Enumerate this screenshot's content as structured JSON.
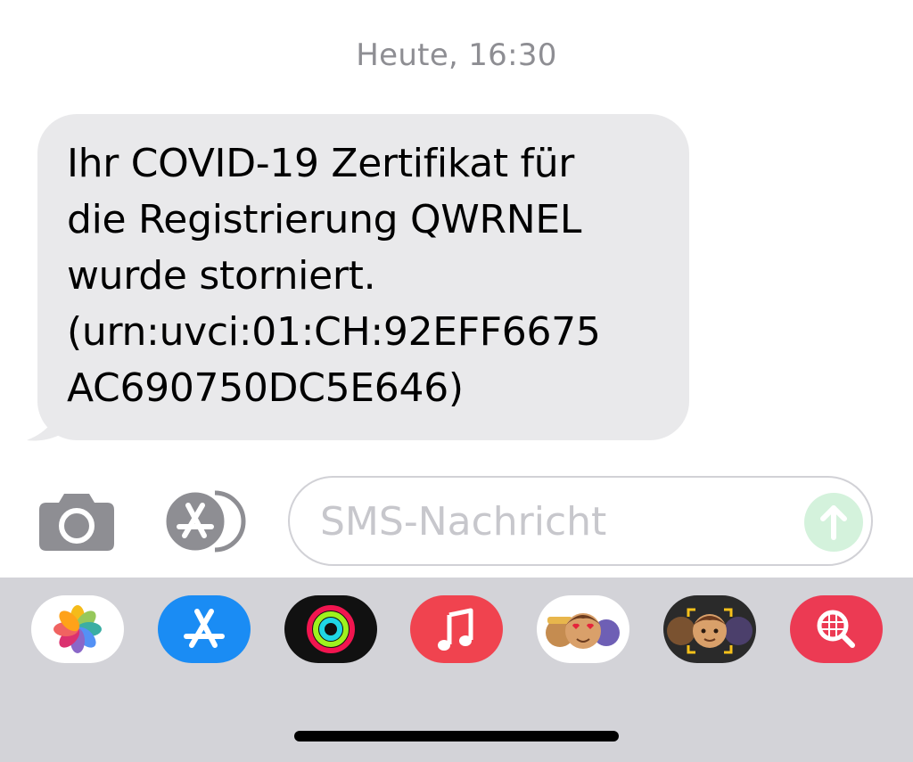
{
  "conversation": {
    "timestamp": "Heute, 16:30",
    "messages": [
      {
        "direction": "incoming",
        "text": "Ihr COVID-19 Zertifikat für\ndie Registrierung QWRNEL\nwurde storniert.\n(urn:uvci:01:CH:92EFF6675\nAC690750DC5E646)"
      }
    ]
  },
  "composer": {
    "camera_icon": "camera-icon",
    "apps_icon": "app-store-icon",
    "placeholder": "SMS-Nachricht",
    "value": "",
    "send_icon": "arrow-up-icon"
  },
  "app_drawer": {
    "apps": [
      {
        "icon": "photos-icon",
        "color": "#ffffff"
      },
      {
        "icon": "app-store-icon",
        "color": "#1a8cf4"
      },
      {
        "icon": "activity-icon",
        "color": "#111111"
      },
      {
        "icon": "music-icon",
        "color": "#f0434f"
      },
      {
        "icon": "memoji-stickers-icon",
        "color": "#ffffff"
      },
      {
        "icon": "memoji-icon",
        "color": "#2a2a2a"
      },
      {
        "icon": "images-search-icon",
        "color": "#ec3a53"
      }
    ]
  },
  "colors": {
    "bubble": "#e9e9eb",
    "timestamp": "#8e8e93",
    "send_button": "#d4f2dc",
    "drawer": "#d3d3d8"
  }
}
